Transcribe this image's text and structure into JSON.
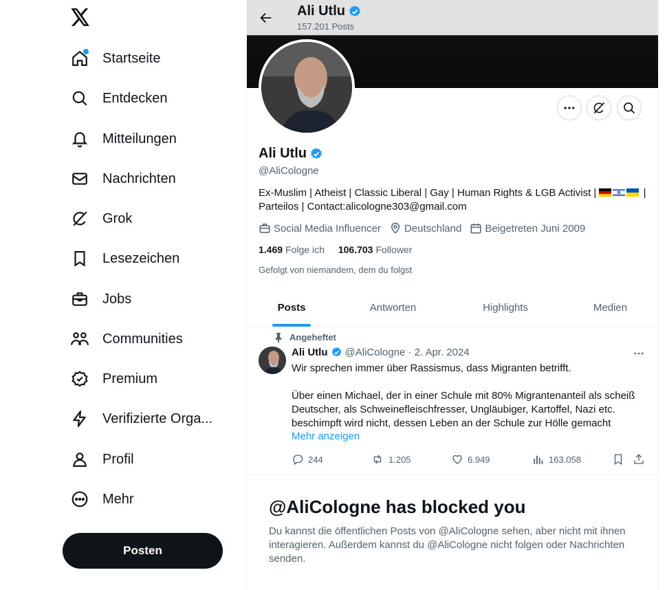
{
  "sidebar": {
    "logo": "x-logo",
    "items": [
      {
        "label": "Startseite",
        "icon": "home-icon",
        "notification": true
      },
      {
        "label": "Entdecken",
        "icon": "search-icon"
      },
      {
        "label": "Mitteilungen",
        "icon": "bell-icon"
      },
      {
        "label": "Nachrichten",
        "icon": "mail-icon"
      },
      {
        "label": "Grok",
        "icon": "grok-icon"
      },
      {
        "label": "Lesezeichen",
        "icon": "bookmark-icon"
      },
      {
        "label": "Jobs",
        "icon": "briefcase-icon"
      },
      {
        "label": "Communities",
        "icon": "people-icon"
      },
      {
        "label": "Premium",
        "icon": "premium-icon"
      },
      {
        "label": "Verifizierte Orga...",
        "icon": "lightning-icon"
      },
      {
        "label": "Profil",
        "icon": "person-icon"
      },
      {
        "label": "Mehr",
        "icon": "more-circle-icon"
      }
    ],
    "post_button": "Posten"
  },
  "header": {
    "name": "Ali Utlu",
    "post_count": "157.201 Posts"
  },
  "profile": {
    "name": "Ali Utlu",
    "handle": "@AliCologne",
    "bio_line1": "Ex-Muslim | Atheist | Classic Liberal | Gay | Human Rights & LGB Activist |",
    "bio_flags": [
      "flag-germany",
      "flag-israel",
      "flag-ukraine"
    ],
    "bio_sep": "|",
    "bio_line2": "Parteilos | Contact:alicologne303@gmail.com",
    "category": "Social Media Influencer",
    "location": "Deutschland",
    "joined": "Beigetreten Juni 2009",
    "following_count": "1.469",
    "following_label": "Folge ich",
    "followers_count": "106.703",
    "followers_label": "Follower",
    "followed_by": "Gefolgt von niemandem, dem du folgst"
  },
  "tabs": [
    "Posts",
    "Antworten",
    "Highlights",
    "Medien"
  ],
  "tweet": {
    "pinned_label": "Angeheftet",
    "name": "Ali Utlu",
    "handle_date": "@AliCologne · 2. Apr. 2024",
    "text_p1": "Wir sprechen immer über Rassismus, dass Migranten betrifft.",
    "text_p2": "Über einen Michael, der in einer Schule mit 80% Migrantenanteil als scheiß Deutscher, als Schweinefleischfresser, Ungläubiger, Kartoffel, Nazi etc. beschimpft wird nicht, dessen Leben an der Schule zur Hölle gemacht",
    "show_more": "Mehr anzeigen",
    "replies": "244",
    "reposts": "1.205",
    "likes": "6.949",
    "views": "163.058"
  },
  "blocked": {
    "title": "@AliCologne has blocked you",
    "text": "Du kannst die öffentlichen Posts von @AliCologne sehen, aber nicht mit ihnen interagieren. Außerdem kannst du @AliCologne nicht folgen oder Nachrichten senden."
  },
  "colors": {
    "accent": "#1d9bf0",
    "text": "#0f1419",
    "secondary": "#536471"
  }
}
